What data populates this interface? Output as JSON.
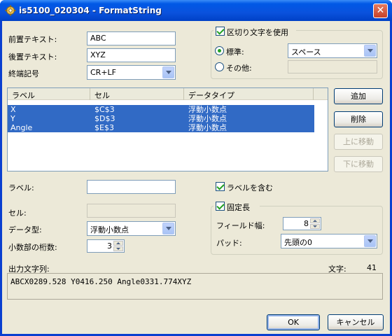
{
  "window": {
    "title": "is5100_020304 - FormatString",
    "close_symbol": "✕"
  },
  "fields": {
    "prefix_label": "前置テキスト:",
    "prefix_value": "ABC",
    "suffix_label": "後置テキスト:",
    "suffix_value": "XYZ",
    "terminator_label": "終端記号",
    "terminator_value": "CR+LF"
  },
  "delimiter": {
    "use_label": "区切り文字を使用",
    "use_checked": true,
    "standard_label": "標準:",
    "standard_value": "スペース",
    "other_label": "その他:",
    "other_value": ""
  },
  "list": {
    "columns": [
      "ラベル",
      "セル",
      "データタイプ"
    ],
    "rows": [
      {
        "label": "X",
        "cell": "$C$3",
        "type": "浮動小数点"
      },
      {
        "label": "Y",
        "cell": "$D$3",
        "type": "浮動小数点"
      },
      {
        "label": "Angle",
        "cell": "$E$3",
        "type": "浮動小数点"
      }
    ]
  },
  "side_buttons": {
    "add": "追加",
    "delete": "削除",
    "move_up": "上に移動",
    "move_down": "下に移動"
  },
  "detail": {
    "label_label": "ラベル:",
    "label_value": "",
    "cell_label": "セル:",
    "cell_value": "",
    "datatype_label": "データ型:",
    "datatype_value": "浮動小数点",
    "decimals_label": "小数部の桁数:",
    "decimals_value": "3"
  },
  "options": {
    "include_label": "ラベルを含む",
    "include_checked": true,
    "fixed_label": "固定長",
    "fixed_checked": true,
    "field_width_label": "フィールド幅:",
    "field_width_value": "8",
    "pad_label": "パッド:",
    "pad_value": "先頭の0"
  },
  "output": {
    "label": "出力文字列:",
    "count_label": "文字:",
    "count_value": "41",
    "text": "ABCX0289.528 Y0416.250 Angle0331.774XYZ"
  },
  "footer": {
    "ok": "OK",
    "cancel": "キャンセル"
  },
  "colors": {
    "titlebar": "#0054e3",
    "selection": "#316ac5",
    "dialog_bg": "#ece9d8"
  }
}
